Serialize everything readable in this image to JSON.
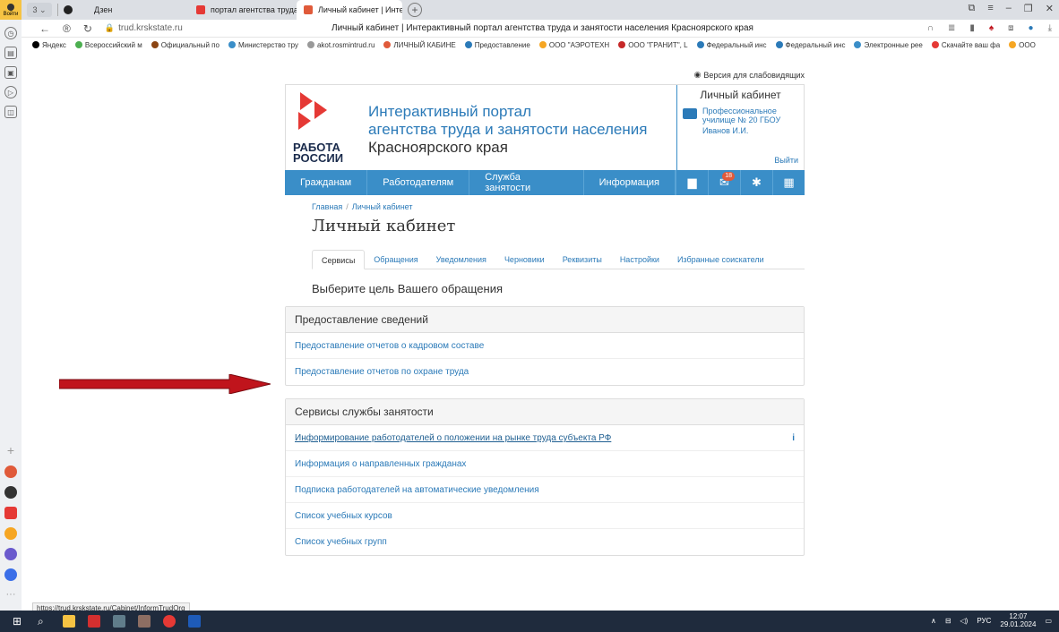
{
  "browser": {
    "user_label": "Войти",
    "tab_count": "3",
    "tabs": [
      {
        "label": "Дзен"
      },
      {
        "label": "портал агентства труда и"
      },
      {
        "label": "Личный кабинет | Инте"
      }
    ],
    "url": "trud.krskstate.ru",
    "page_title": "Личный кабинет | Интерактивный портал агентства труда и занятости населения Красноярского края",
    "bookmarks": [
      {
        "label": "Яндекс",
        "color": "#000000"
      },
      {
        "label": "Всероссийский м",
        "color": "#4caf50"
      },
      {
        "label": "Официальный по",
        "color": "#8b4513"
      },
      {
        "label": "Министерство тру",
        "color": "#3a8ec8"
      },
      {
        "label": "akot.rosmintrud.ru",
        "color": "#999999"
      },
      {
        "label": "ЛИЧНЫЙ КАБИНЕ",
        "color": "#e05a3a"
      },
      {
        "label": "Предоставление",
        "color": "#2b7ab8"
      },
      {
        "label": "ООО \"АЭРОТЕХН",
        "color": "#f6a623"
      },
      {
        "label": "ООО \"ГРАНИТ\", L",
        "color": "#c62828"
      },
      {
        "label": "Федеральный инс",
        "color": "#2b7ab8"
      },
      {
        "label": "Федеральный инс",
        "color": "#2b7ab8"
      },
      {
        "label": "Электронные рее",
        "color": "#3a8ec8"
      },
      {
        "label": "Скачайте ваш фа",
        "color": "#e53935"
      },
      {
        "label": "ООО",
        "color": "#f6a623"
      }
    ],
    "status_url": "https://trud.krskstate.ru/Cabinet/InformTrudOrg"
  },
  "site": {
    "accessibility_link": "Версия для слабовидящих",
    "logo_line1": "РАБОТА",
    "logo_line2": "РОССИИ",
    "portal_line1": "Интерактивный портал",
    "portal_line2": "агентства труда и занятости населения",
    "portal_line3": "Красноярского края",
    "cabinet": {
      "title": "Личный кабинет",
      "org_line1": "Профессиональное",
      "org_line2": "училище № 20 ГБОУ",
      "user": "Иванов И.И.",
      "exit": "Выйти"
    },
    "menu": [
      "Гражданам",
      "Работодателям",
      "Служба занятости",
      "Информация"
    ],
    "mail_count": "18",
    "breadcrumb": {
      "home": "Главная",
      "sep": "/",
      "current": "Личный кабинет"
    },
    "heading": "Личный кабинет",
    "tabs": [
      "Сервисы",
      "Обращения",
      "Уведомления",
      "Черновики",
      "Реквизиты",
      "Настройки",
      "Избранные соискатели"
    ],
    "choose_text": "Выберите цель Вашего обращения",
    "panel1": {
      "title": "Предоставление сведений",
      "items": [
        "Предоставление отчетов о кадровом составе",
        "Предоставление отчетов по охране труда"
      ]
    },
    "panel2": {
      "title": "Сервисы службы занятости",
      "items": [
        "Информирование работодателей о положении на рынке труда субъекта РФ",
        "Информация о направленных гражданах",
        "Подписка работодателей на автоматические уведомления",
        "Список учебных курсов",
        "Список учебных групп"
      ],
      "info_icon": "i"
    }
  },
  "taskbar": {
    "lang": "РУС",
    "time": "12:07",
    "date": "29.01.2024"
  },
  "colors": {
    "brand_blue": "#3a8ec8",
    "link_blue": "#2b7ab8",
    "arrow_red": "#c0141c"
  }
}
